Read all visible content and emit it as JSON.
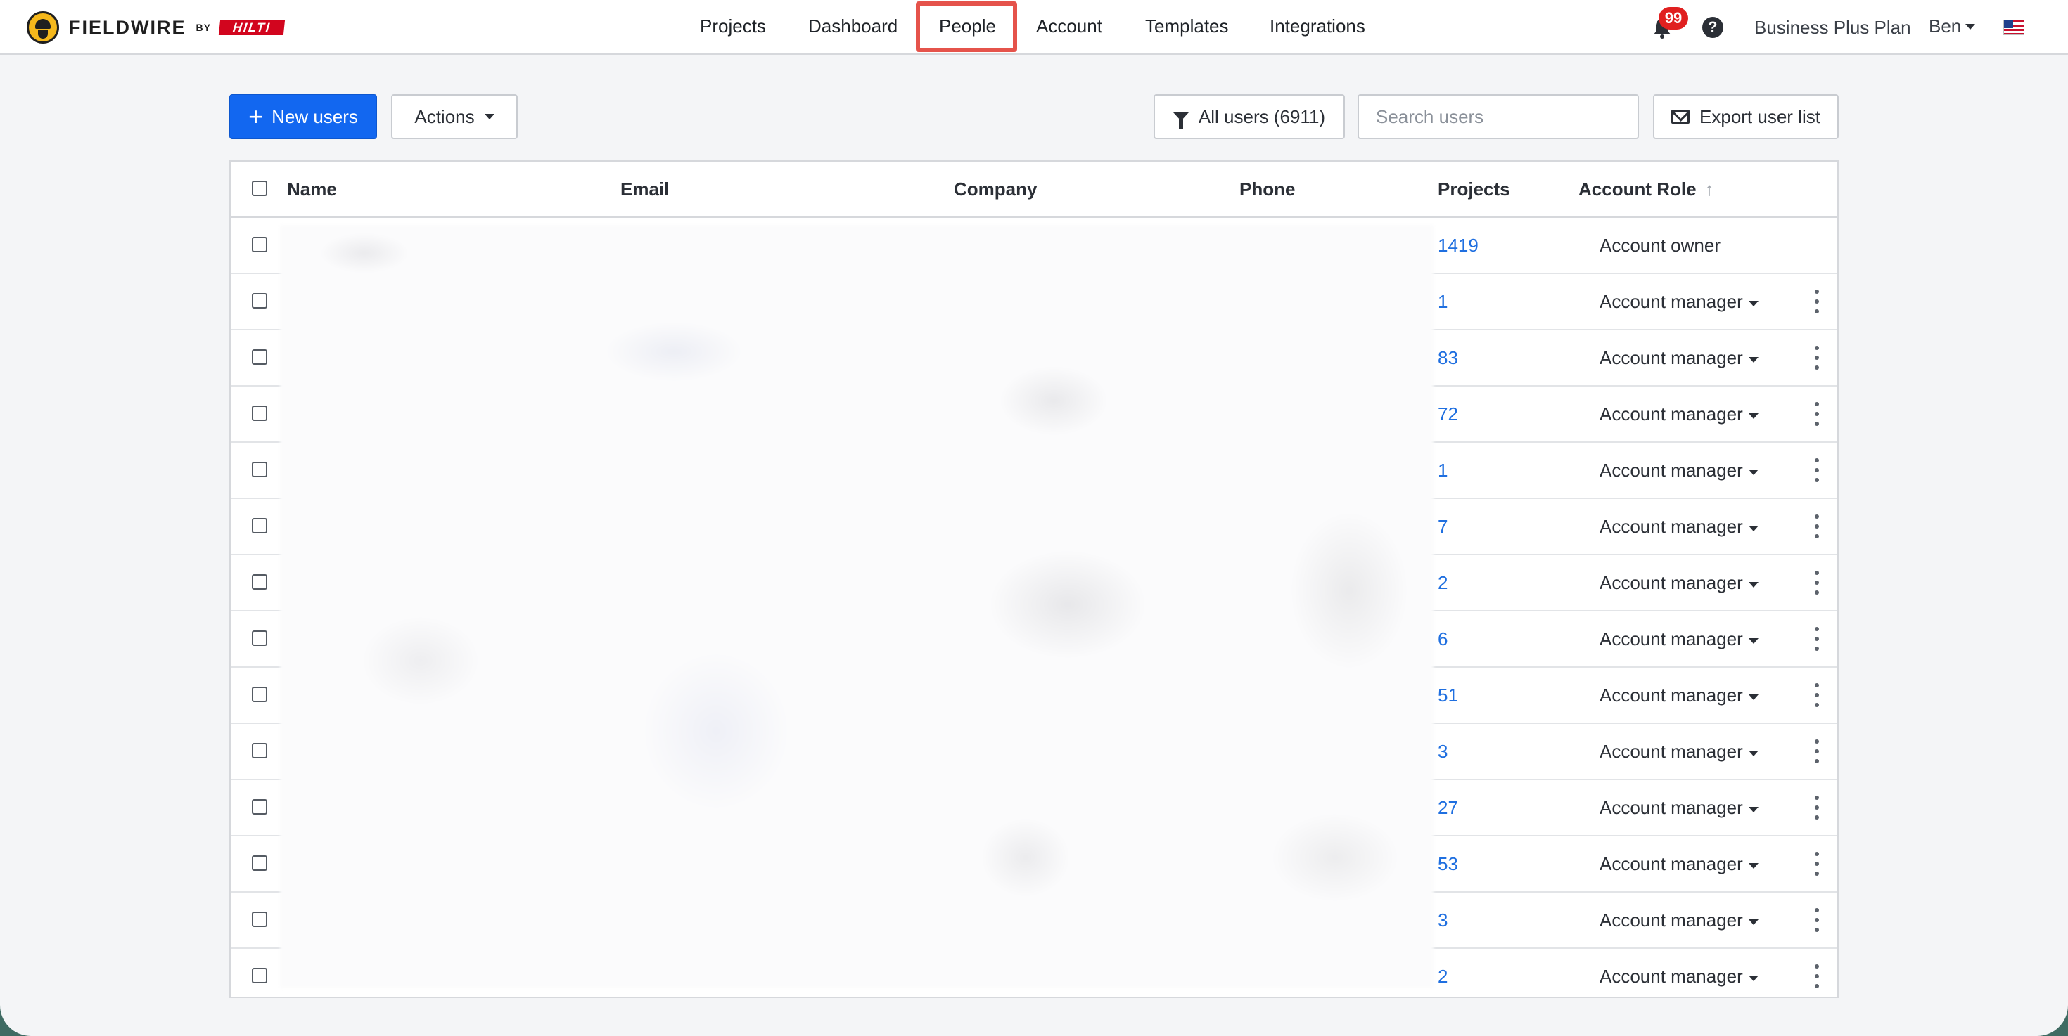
{
  "brand": {
    "name": "FIELDWIRE",
    "by": "BY",
    "partner": "HILTI"
  },
  "nav": {
    "items": [
      "Projects",
      "Dashboard",
      "People",
      "Account",
      "Templates",
      "Integrations"
    ],
    "active": "People"
  },
  "header_right": {
    "notification_count": "99",
    "help": "?",
    "plan": "Business Plus Plan",
    "user": "Ben"
  },
  "toolbar": {
    "new_users_label": "New users",
    "actions_label": "Actions",
    "filter_label": "All users (6911)",
    "search_placeholder": "Search users",
    "export_label": "Export user list"
  },
  "table": {
    "columns": {
      "name": "Name",
      "email": "Email",
      "company": "Company",
      "phone": "Phone",
      "projects": "Projects",
      "account_role": "Account Role"
    },
    "rows": [
      {
        "projects": "1419",
        "role": "Account owner"
      },
      {
        "projects": "1",
        "role": "Account manager"
      },
      {
        "projects": "83",
        "role": "Account manager"
      },
      {
        "projects": "72",
        "role": "Account manager"
      },
      {
        "projects": "1",
        "role": "Account manager"
      },
      {
        "projects": "7",
        "role": "Account manager"
      },
      {
        "projects": "2",
        "role": "Account manager"
      },
      {
        "projects": "6",
        "role": "Account manager"
      },
      {
        "projects": "51",
        "role": "Account manager"
      },
      {
        "projects": "3",
        "role": "Account manager"
      },
      {
        "projects": "27",
        "role": "Account manager"
      },
      {
        "projects": "53",
        "role": "Account manager"
      },
      {
        "projects": "3",
        "role": "Account manager"
      },
      {
        "projects": "2",
        "role": "Account manager"
      }
    ]
  },
  "colors": {
    "primary": "#1267f0",
    "link": "#1f6fe0",
    "highlight": "#e5534b",
    "badge": "#e02020"
  }
}
